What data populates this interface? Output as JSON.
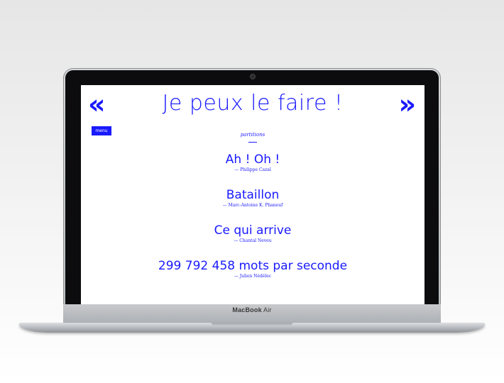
{
  "device": {
    "brand_bold": "MacBook",
    "brand_light": "Air"
  },
  "page": {
    "prev_label": "«",
    "next_label": "»",
    "title": "Je peux le faire !",
    "menu_label": "menu",
    "section_label": "partitions",
    "items": [
      {
        "title": "Ah ! Oh !",
        "author": "— Philippe Cazal"
      },
      {
        "title": "Bataillon",
        "author": "— Marc-Antoine K. Phaneuf"
      },
      {
        "title": "Ce qui arrive",
        "author": "— Chantal Neveu"
      },
      {
        "title": "299 792 458 mots par seconde",
        "author": "— Julien Nédélec"
      }
    ]
  },
  "colors": {
    "accent": "#1a1aff",
    "screen_bg": "#ffffff"
  }
}
